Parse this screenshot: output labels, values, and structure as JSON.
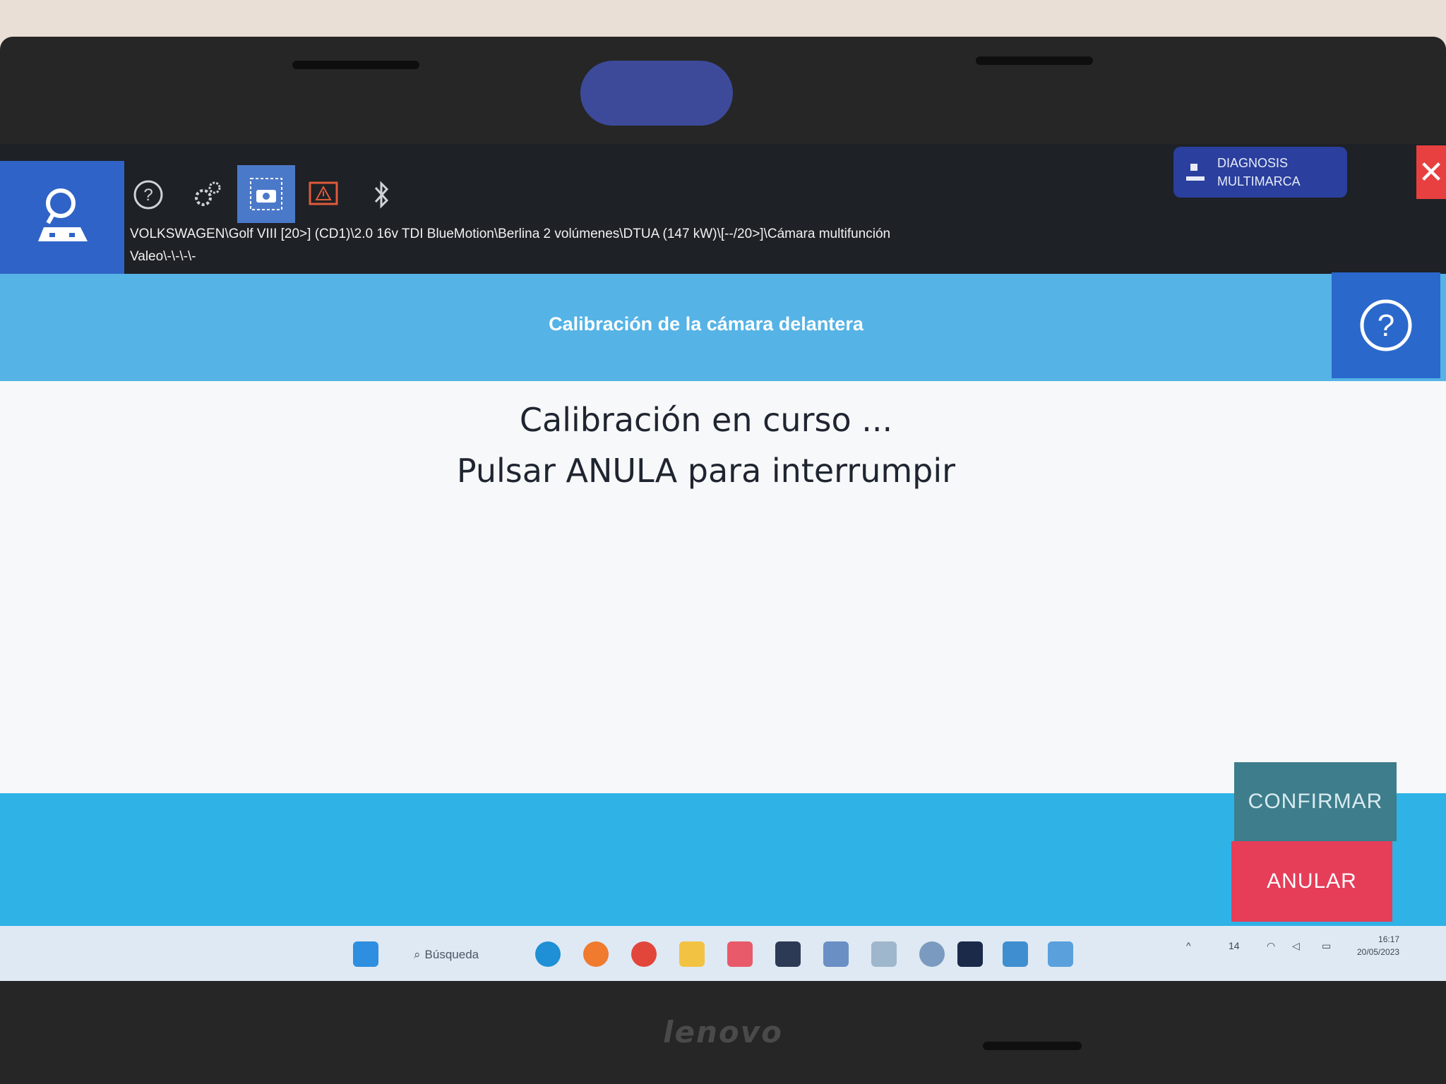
{
  "device": {
    "brand": "lenovo"
  },
  "toolbar": {
    "icons": [
      "search-car-icon",
      "help-icon",
      "settings-gears-icon",
      "screenshot-camera-icon",
      "warning-report-icon",
      "bluetooth-icon"
    ]
  },
  "breadcrumb": {
    "line1": "VOLKSWAGEN\\Golf VIII [20>] (CD1)\\2.0 16v TDI BlueMotion\\Berlina 2 volúmenes\\DTUA (147 kW)\\[--/20>]\\Cámara multifunción",
    "line2": "Valeo\\-\\-\\-\\-"
  },
  "header": {
    "diag_line1": "DIAGNOSIS",
    "diag_line2": "MULTIMARCA",
    "close_symbol": "✕"
  },
  "page": {
    "title": "Calibración de la cámara delantera",
    "message_line1": "Calibración en curso ...",
    "message_line2": "Pulsar ANULA para interrumpir"
  },
  "actions": {
    "confirm_label": "CONFIRMAR",
    "cancel_label": "ANULAR"
  },
  "taskbar": {
    "search_label": "Búsqueda",
    "time": "16:17",
    "date": "20/05/2023",
    "calendar_badge": "14"
  },
  "colors": {
    "accent_blue": "#2f63c7",
    "title_band": "#55b3e6",
    "bottom_band": "#2fb2e6",
    "confirm": "#3e7d8b",
    "cancel": "#e63d58"
  }
}
